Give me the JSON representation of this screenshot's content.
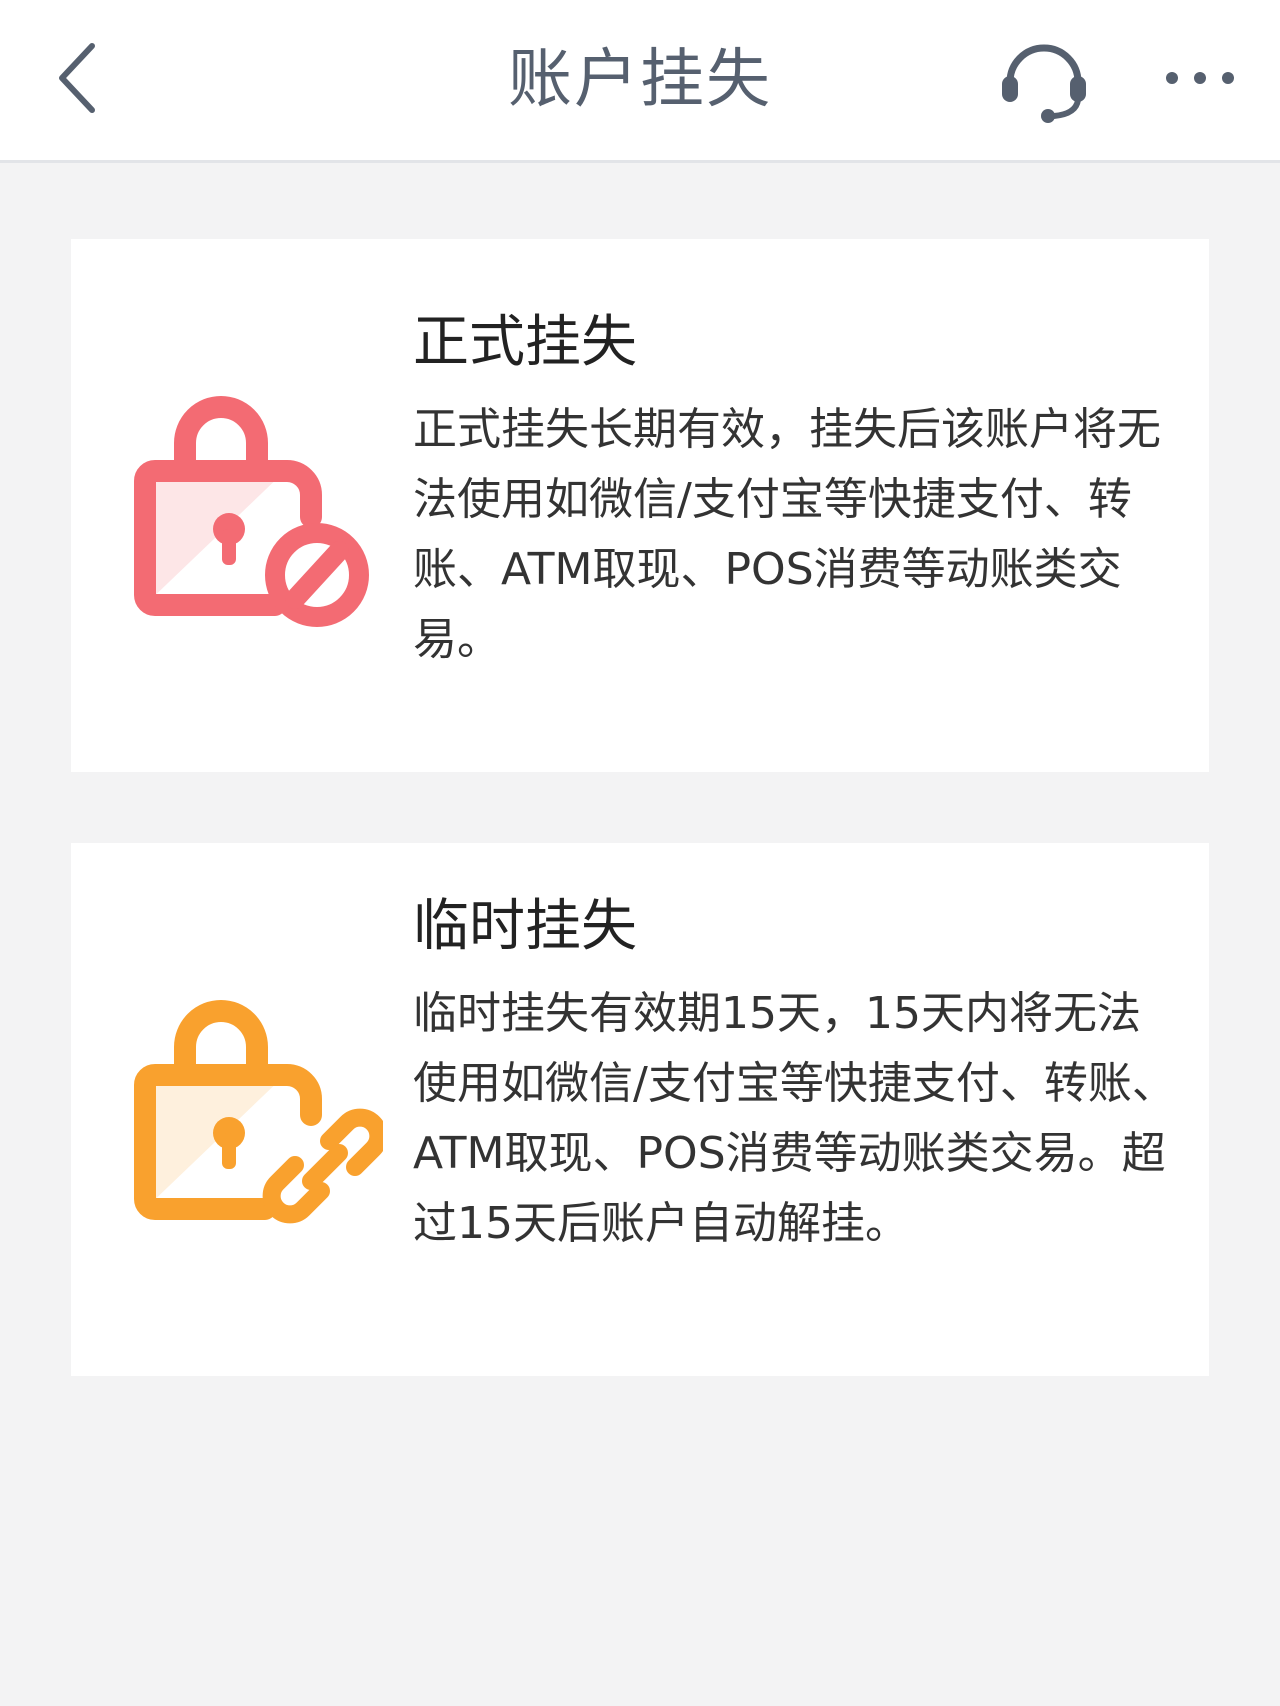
{
  "header": {
    "title": "账户挂失",
    "back_icon": "chevron-left-icon",
    "support_icon": "headset-icon",
    "more_icon": "more-dots-icon"
  },
  "options": [
    {
      "title": "正式挂失",
      "description": "正式挂失长期有效，挂失后该账户将无法使用如微信/支付宝等快捷支付、转账、ATM取现、POS消费等动账类交易。",
      "icon": "lock-forbidden-icon",
      "color": "#f36b73"
    },
    {
      "title": "临时挂失",
      "description": "临时挂失有效期15天，15天内将无法使用如微信/支付宝等快捷支付、转账、ATM取现、POS消费等动账类交易。超过15天后账户自动解挂。",
      "icon": "lock-link-icon",
      "color": "#f9a12e"
    }
  ],
  "colors": {
    "background": "#f3f3f4",
    "header_background": "#ffffff",
    "title_text": "#56606f"
  }
}
